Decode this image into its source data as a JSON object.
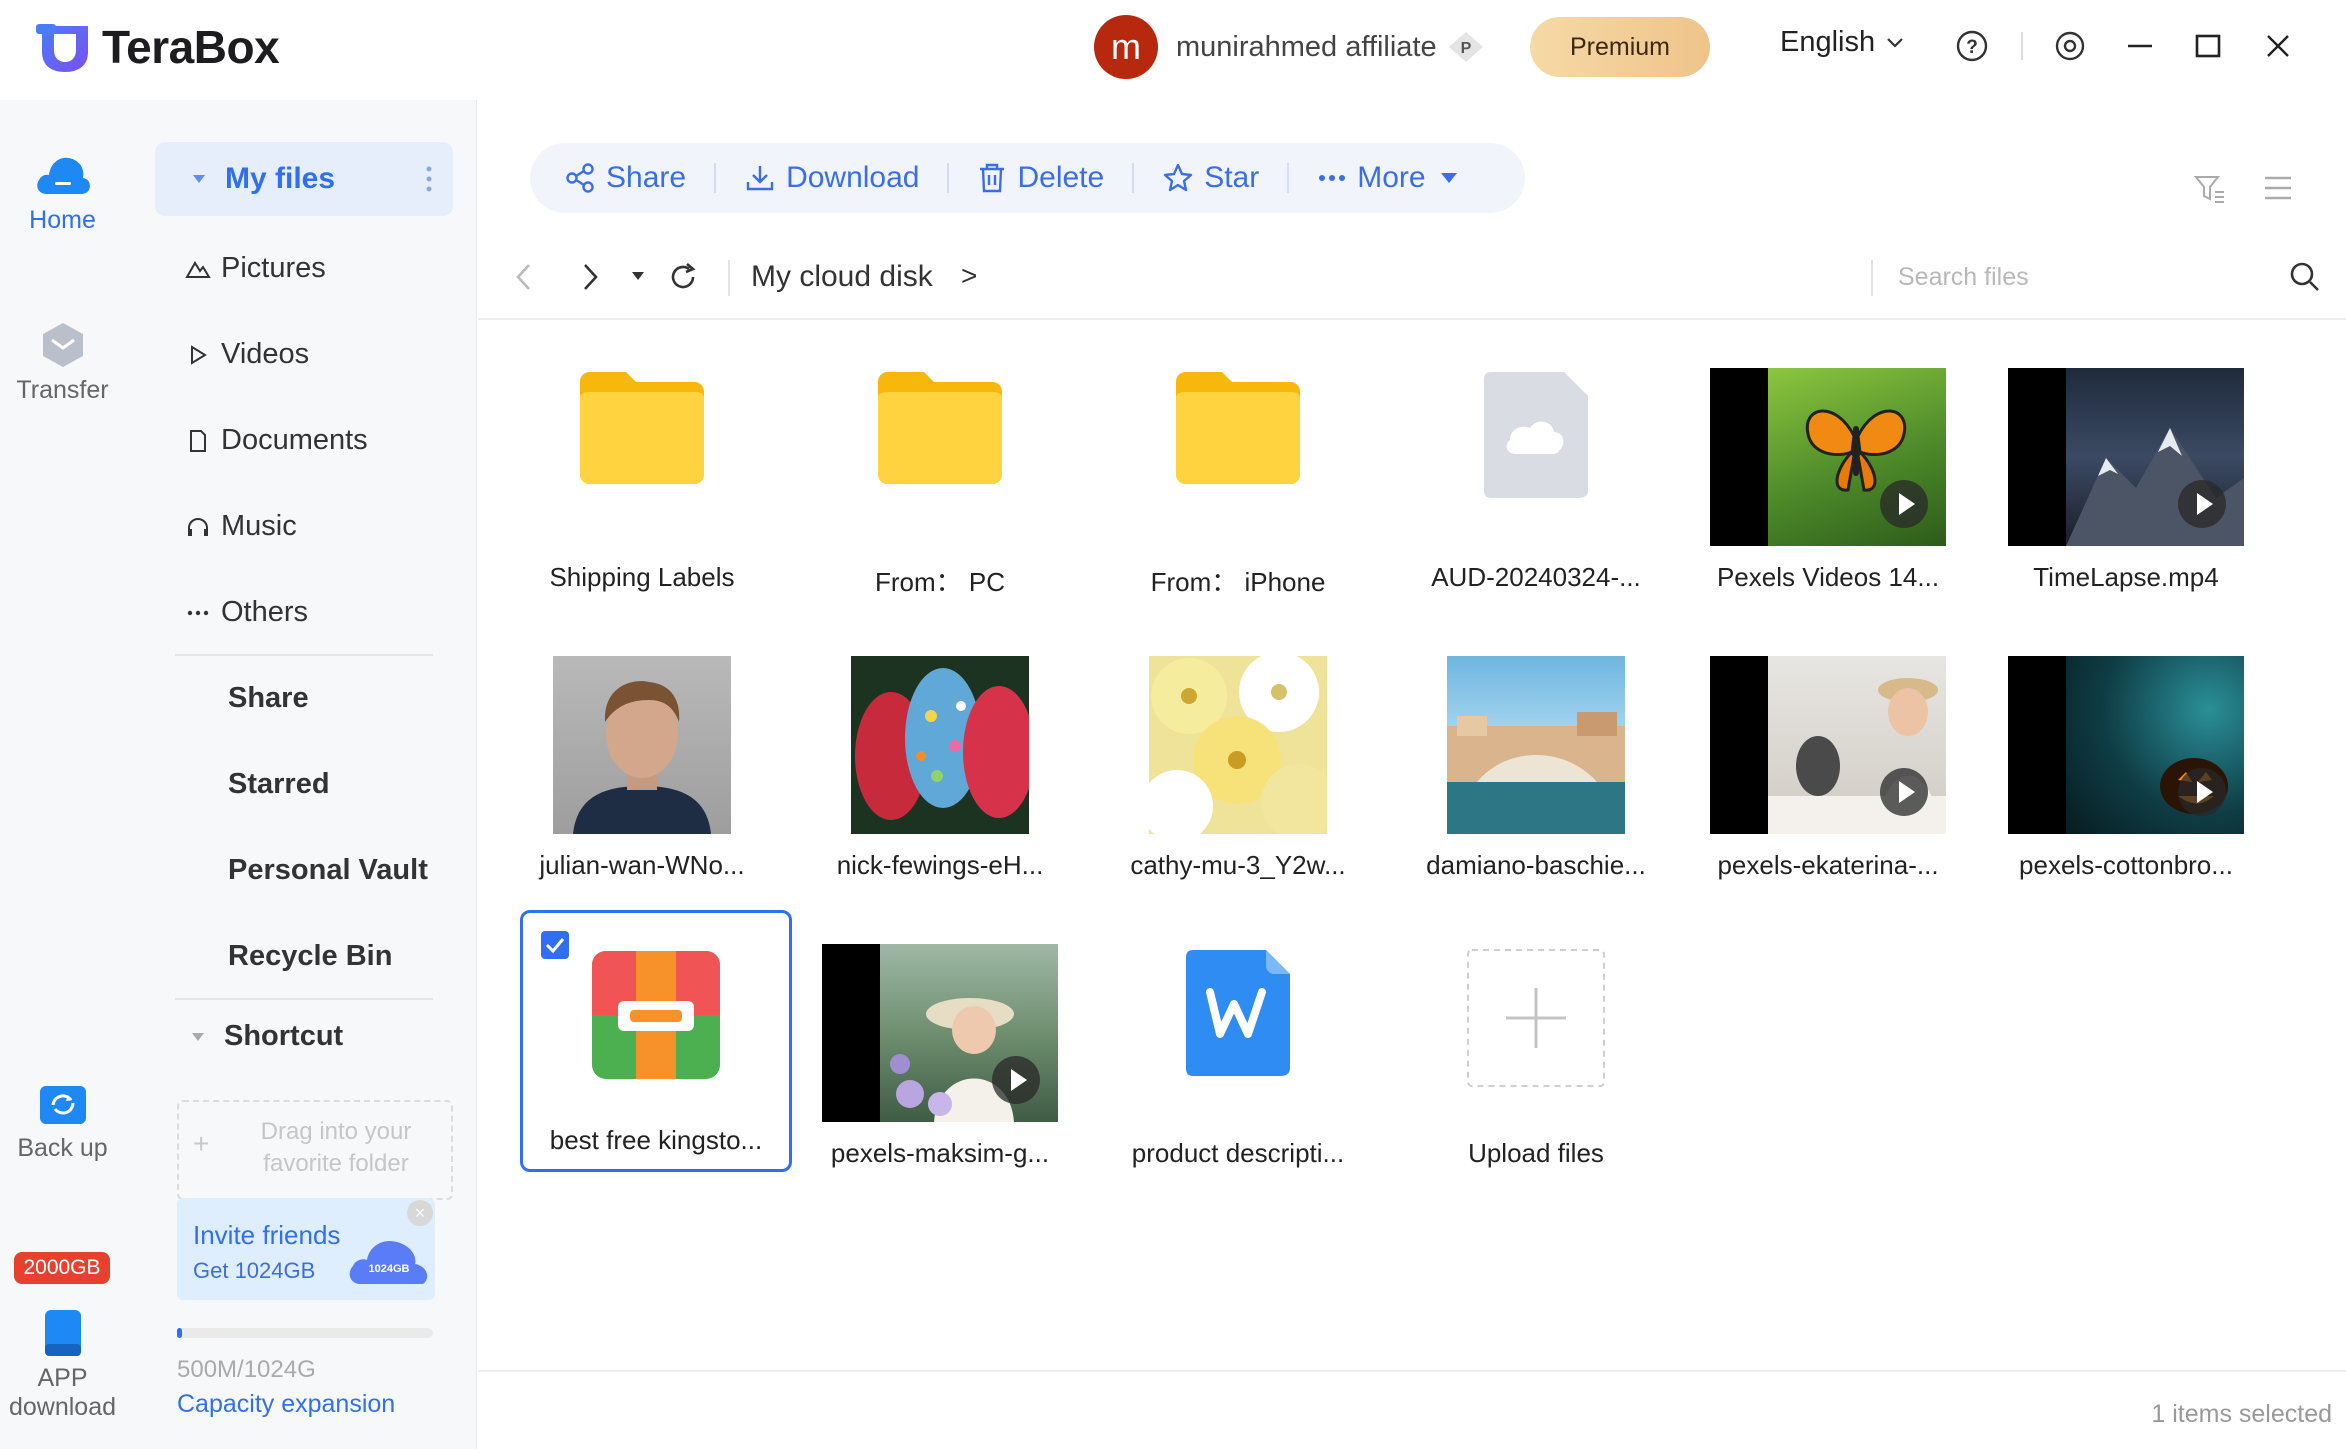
{
  "app": {
    "name": "TeraBox"
  },
  "header": {
    "user_initial": "m",
    "username": "munirahmed affiliate",
    "premium_label": "Premium",
    "language": "English"
  },
  "rail": {
    "home": "Home",
    "transfer": "Transfer",
    "backup": "Back up",
    "storage_badge": "2000GB",
    "app_download_line1": "APP",
    "app_download_line2": "download"
  },
  "sidebar": {
    "my_files": "My files",
    "categories": [
      "Pictures",
      "Videos",
      "Documents",
      "Music",
      "Others"
    ],
    "links": [
      "Share",
      "Starred",
      "Personal Vault",
      "Recycle Bin"
    ],
    "shortcut": "Shortcut",
    "drop_hint": "Drag into your favorite folder",
    "invite_title": "Invite friends",
    "invite_sub": "Get 1024GB",
    "invite_badge": "1024GB",
    "storage_used": "500M/1024G",
    "storage_fraction": 0.02,
    "capacity_link": "Capacity expansion"
  },
  "toolbar": {
    "share": "Share",
    "download": "Download",
    "delete": "Delete",
    "star": "Star",
    "more": "More"
  },
  "nav": {
    "path": "My cloud disk",
    "path_arrow": ">",
    "search_placeholder": "Search files"
  },
  "files": [
    {
      "name": "Shipping Labels",
      "kind": "folder"
    },
    {
      "name": "From： PC",
      "kind": "folder"
    },
    {
      "name": "From： iPhone",
      "kind": "folder"
    },
    {
      "name": "AUD-20240324-...",
      "kind": "audio"
    },
    {
      "name": "Pexels Videos 14...",
      "kind": "video"
    },
    {
      "name": "TimeLapse.mp4",
      "kind": "video"
    },
    {
      "name": "julian-wan-WNo...",
      "kind": "image"
    },
    {
      "name": "nick-fewings-eH...",
      "kind": "image"
    },
    {
      "name": "cathy-mu-3_Y2w...",
      "kind": "image"
    },
    {
      "name": "damiano-baschie...",
      "kind": "image"
    },
    {
      "name": "pexels-ekaterina-...",
      "kind": "video"
    },
    {
      "name": "pexels-cottonbro...",
      "kind": "video"
    },
    {
      "name": "best free kingsto...",
      "kind": "archive",
      "selected": true
    },
    {
      "name": "pexels-maksim-g...",
      "kind": "video"
    },
    {
      "name": "product descripti...",
      "kind": "word"
    },
    {
      "name": "Upload files",
      "kind": "upload"
    }
  ],
  "status": {
    "selected_text": "1 items selected"
  },
  "colors": {
    "accent": "#2f6ff0",
    "folder": "#fbc02d",
    "premium": "#f0c98d"
  }
}
